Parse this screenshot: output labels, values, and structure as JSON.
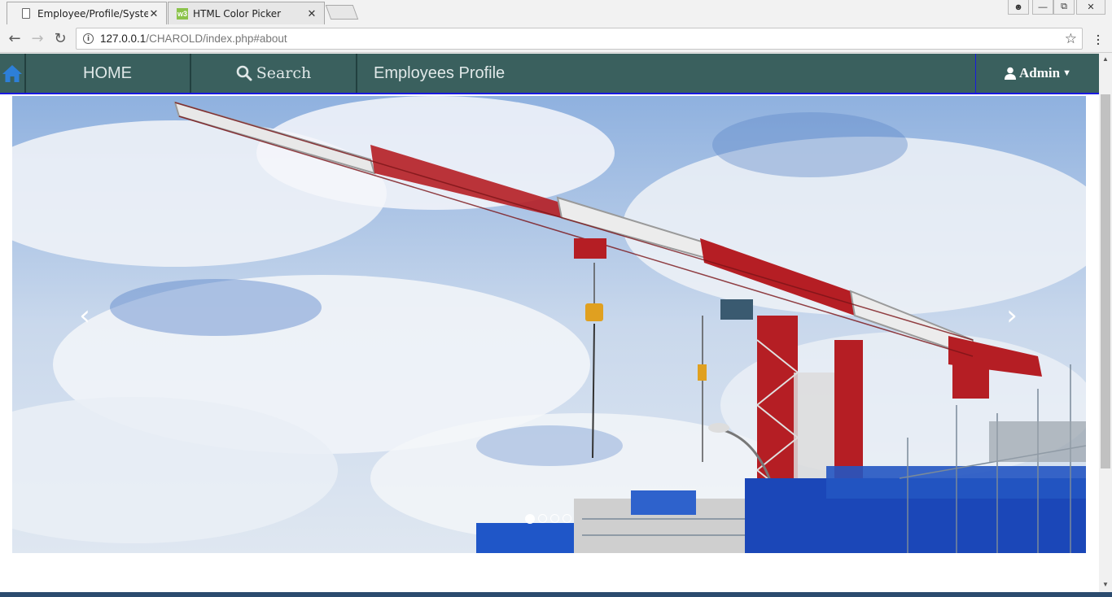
{
  "browser": {
    "tabs": [
      {
        "title": "Employee/Profile/System",
        "active": true,
        "icon": "document-icon"
      },
      {
        "title": "HTML Color Picker",
        "active": false,
        "icon": "w3schools-icon"
      }
    ],
    "url_host": "127.0.0.1",
    "url_path": "/CHAROLD/index.php#about"
  },
  "navbar": {
    "home_label": "HOME",
    "search_label": "Search",
    "profile_label": "Employees Profile",
    "admin_label": "Admin",
    "bg_color": "#3a605e"
  },
  "carousel": {
    "slide_count": 4,
    "active_index": 0,
    "image": "construction-tower-crane"
  }
}
